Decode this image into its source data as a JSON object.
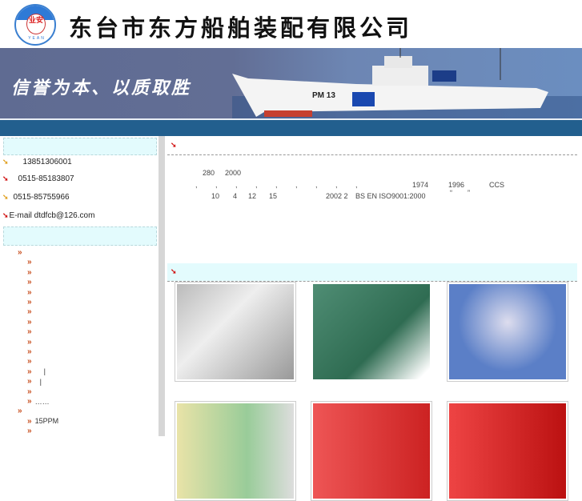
{
  "header": {
    "company_name": "东台市东方船舶装配有限公司",
    "logo_text": "业安",
    "logo_sub": "YEAN"
  },
  "banner": {
    "slogan": "信誉为本、以质取胜",
    "ship_label": "PM 13"
  },
  "contacts": [
    {
      "text": "13851306001",
      "color": "orange"
    },
    {
      "text": "0515-85183807",
      "color": "red"
    },
    {
      "text": "0515-85755966",
      "color": "orange"
    },
    {
      "text": "E-mail dtdfcb@126.com",
      "color": "red"
    }
  ],
  "menu": {
    "groups": [
      {
        "label": "",
        "items": [
          "",
          "",
          "",
          "",
          "",
          "",
          "",
          "",
          "",
          "",
          "",
          "|",
          "|",
          "",
          "……"
        ]
      },
      {
        "label": "",
        "items": [
          "15PPM",
          ""
        ]
      }
    ]
  },
  "about": {
    "line1": [
      "280",
      "2000"
    ],
    "line2": [
      "1974",
      "1996",
      "CCS"
    ],
    "line3": [
      "10",
      "4",
      "12",
      "15",
      "2002 2",
      "BS EN ISO9001:2000",
      "“",
      "”"
    ]
  },
  "products": [
    "sewage-treatment-unit",
    "oil-water-separator",
    "breathing-apparatus",
    "product-4",
    "product-5",
    "product-6"
  ]
}
